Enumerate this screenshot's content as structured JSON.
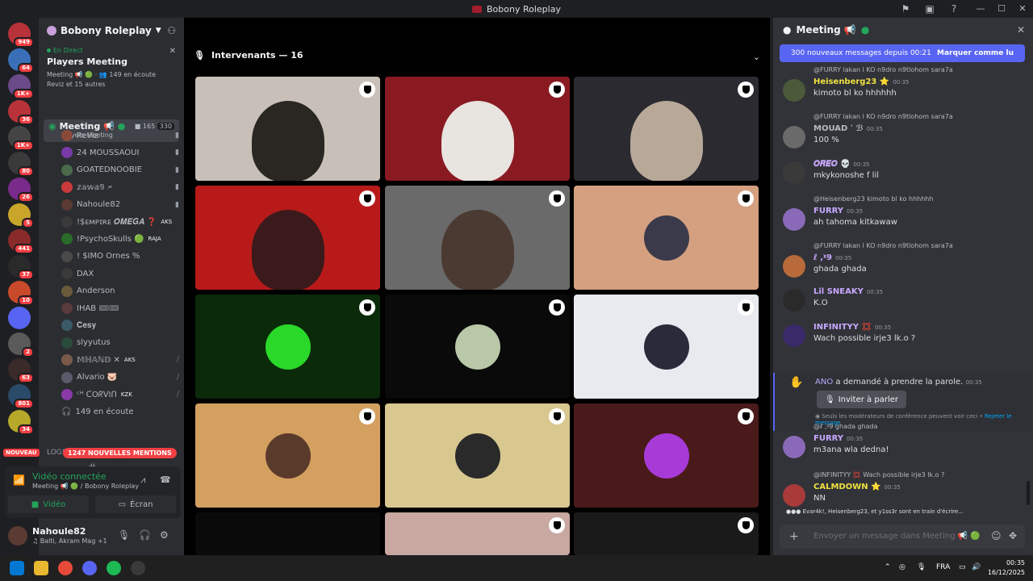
{
  "window": {
    "title": "Bobony Roleplay"
  },
  "guilds": [
    {
      "badge": "949",
      "color": "#b8323a"
    },
    {
      "badge": "64",
      "color": "#3a6fb8"
    },
    {
      "badge": "1K+",
      "color": "#6b4a8a"
    },
    {
      "badge": "36",
      "color": "#b8323a"
    },
    {
      "badge": "1K+",
      "color": "#444"
    },
    {
      "badge": "80",
      "color": "#3a3a3a"
    },
    {
      "badge": "26",
      "color": "#7a2a8a"
    },
    {
      "badge": "5",
      "color": "#c9a52a"
    },
    {
      "badge": "441",
      "color": "#8a2a2a"
    },
    {
      "badge": "37",
      "color": "#2a2a2a"
    },
    {
      "badge": "10",
      "color": "#c94a2a"
    },
    {
      "badge": "",
      "color": "#5865f2"
    },
    {
      "badge": "2",
      "color": "#5a5a5a"
    },
    {
      "badge": "63",
      "color": "#3a2a2a"
    },
    {
      "badge": "801",
      "color": "#2a4a6a"
    },
    {
      "badge": "34",
      "color": "#b8a82a"
    }
  ],
  "server": {
    "name": "Bobony Roleplay"
  },
  "live": {
    "tag": "En Direct",
    "title": "Players Meeting",
    "sub": "Meeting 📢 🟢 · 👥 149 en écoute",
    "sub2": "Reviz et 15 autres"
  },
  "voice_channel": {
    "name": "Meeting 📢",
    "sub": "Players Meeting",
    "count1": "165",
    "count2": "330"
  },
  "voice_users": [
    {
      "name": "Reviz",
      "color": "#8a4a3a",
      "right": "▮",
      "tag": ""
    },
    {
      "name": "24 MOUSSAOUI",
      "color": "#7a3aa8",
      "right": "▮",
      "tag": ""
    },
    {
      "name": "GOATEDNOOBIE",
      "color": "#4a6a4a",
      "right": "▮",
      "tag": ""
    },
    {
      "name": "𝕫𝕒𝕨𝕒𝟡 🗲",
      "color": "#c93a3a",
      "right": "▮",
      "tag": ""
    },
    {
      "name": "Nahoule82",
      "color": "#5a3a32",
      "right": "▮",
      "tag": ""
    },
    {
      "name": "!$ᴇᴍᴘɪʀᴇ 𝑶𝑴𝑬𝑮𝑨 ❓",
      "color": "#3a3a3a",
      "right": "",
      "tag": "AKS"
    },
    {
      "name": "!PsychoSkulls 🟢",
      "color": "#2a6a2a",
      "right": "",
      "tag": "RAJA"
    },
    {
      "name": "! $IMO Ornes %",
      "color": "#4a4a4a",
      "right": "",
      "tag": ""
    },
    {
      "name": "DAX",
      "color": "#3a3a3a",
      "right": "",
      "tag": ""
    },
    {
      "name": "Anderson",
      "color": "#6a5a3a",
      "right": "",
      "tag": ""
    },
    {
      "name": "IHAB 🎟🎟",
      "color": "#5a3a3a",
      "right": "",
      "tag": ""
    },
    {
      "name": "𝐂𝐞𝐬𝐲",
      "color": "#3a5a6a",
      "right": "",
      "tag": ""
    },
    {
      "name": "slyyutus",
      "color": "#2a4a3a",
      "right": "",
      "tag": ""
    },
    {
      "name": "𝕄ℍ𝔸ℕ𝔻 ✕",
      "color": "#7a5a4a",
      "right": "⧸",
      "tag": "AKS"
    },
    {
      "name": "Alvario 🐷",
      "color": "#5a5a6a",
      "right": "⧸",
      "tag": ""
    },
    {
      "name": "ᶜᴴ ᑕOᖇᐯIᑎ",
      "color": "#8a3aa8",
      "right": "⧸",
      "tag": "KZK"
    }
  ],
  "listening": "149 en écoute",
  "logs_label": "LOGS ⌄",
  "mentions": "1247 NOUVELLES MENTIONS",
  "nouveau": "NOUVEAU",
  "voice_panel": {
    "status": "Vidéo connectée",
    "sub": "Meeting 📢 🟢 / Bobony Roleplay",
    "video": "Vidéo",
    "screen": "Écran"
  },
  "user": {
    "name": "Nahoule82",
    "status": "♫ Balti, Akram Mag +1"
  },
  "stage": {
    "header": "Intervenants — 16"
  },
  "tiles": [
    {
      "bg": "#c8c0b8",
      "person": "#2a2622",
      "avatar": ""
    },
    {
      "bg": "#8a1a22",
      "person": "#e8e4e0",
      "avatar": ""
    },
    {
      "bg": "#2a2a30",
      "person": "#b8a898",
      "avatar": ""
    },
    {
      "bg": "#b81a1a",
      "person": "#3a1a1a",
      "avatar": ""
    },
    {
      "bg": "#6a6a6a",
      "person": "#4a3a32",
      "avatar": ""
    },
    {
      "bg": "#d4a080",
      "person": "",
      "avatar": "#3a3a4a"
    },
    {
      "bg": "#0a2a0a",
      "person": "",
      "avatar": "#2ad82a"
    },
    {
      "bg": "#0a0a0a",
      "person": "",
      "avatar": "#b8c8a8"
    },
    {
      "bg": "#e8eaf0",
      "person": "",
      "avatar": "#2a2a3a"
    },
    {
      "bg": "#d4a060",
      "person": "",
      "avatar": "#5a3a2a"
    },
    {
      "bg": "#d8c890",
      "person": "",
      "avatar": "#2a2a2a"
    },
    {
      "bg": "#4a1a1a",
      "person": "",
      "avatar": "#a83ad8"
    },
    {
      "bg": "#0a0a0a",
      "person": "",
      "avatar": ""
    },
    {
      "bg": "#c8a8a0",
      "person": "",
      "avatar": ""
    },
    {
      "bg": "#1a1a1a",
      "person": "",
      "avatar": ""
    }
  ],
  "chat": {
    "title": "Meeting 📢",
    "new_messages": "300 nouveaux messages depuis 00:21",
    "mark_read": "Marquer comme lu",
    "messages": [
      {
        "reply": "@FURRY lakan l KO n9dro n9tlohom sara7a",
        "author": "Heisenberg23 ⭐",
        "color": "#f0e040",
        "time": "00:35",
        "text": "kimoto bl ko hhhhhh",
        "av": "#4a5a3a"
      },
      {
        "reply": "@FURRY lakan l KO n9dro n9tlohom sara7a",
        "author": "MOUAD ˈ ℬ",
        "color": "#b5bac1",
        "time": "00:35",
        "text": "100 %",
        "av": "#6a6a6a"
      },
      {
        "reply": "",
        "author": "𝑶𝑹𝑬𝑶 💀",
        "color": "#c8a8ff",
        "time": "00:35",
        "text": "mkykonoshe f lil",
        "av": "#3a3a3a"
      },
      {
        "reply": "@Heisenberg23 kimoto bl ko hhhhhh",
        "author": "FURRY",
        "color": "#c8a8ff",
        "time": "00:35",
        "text": "ah tahoma kitkawaw",
        "av": "#8a6ab8"
      },
      {
        "reply": "@FURRY lakan l KO n9dro n9tlohom sara7a",
        "author": "ℓ ,ᵡ9",
        "color": "#c8a8ff",
        "time": "00:35",
        "text": "ghada ghada",
        "av": "#b86a3a"
      },
      {
        "reply": "",
        "author": "Lil SNEAKY",
        "color": "#c8a8ff",
        "time": "00:35",
        "text": "K.O",
        "av": "#2a2a2a"
      },
      {
        "reply": "",
        "author": "INFINITYY 💢",
        "color": "#c8a8ff",
        "time": "00:35",
        "text": "Wach possible irje3 lk.o ?",
        "av": "#3a2a6a"
      }
    ],
    "request": {
      "user": "ANO",
      "text": "a demandé à prendre la parole.",
      "time": "00:35",
      "invite": "Inviter à parler",
      "note": "Seuls les modérateurs de conférence peuvent voir ceci •",
      "reject": "Rejeter le message"
    },
    "messages2": [
      {
        "reply": "@ℓ ,ᵡ9 ghada ghada",
        "author": "FURRY",
        "color": "#c8a8ff",
        "time": "00:35",
        "text": "m3ana wla dedna!",
        "av": "#8a6ab8"
      },
      {
        "reply": "@INFINITYY 💢 Wach possible irje3 lk.o ?",
        "author": "CALMDOWN ⭐",
        "color": "#f0e040",
        "time": "00:35",
        "text": "NN",
        "av": "#a83a3a"
      }
    ],
    "typing": "Evar4k!, Heisenberg23, et y1ss3r sont en train d'écrire...",
    "input_placeholder": "Envoyer un message dans Meeting 📢 🟢"
  },
  "taskbar": {
    "lang": "FRA",
    "time": "00:35",
    "date": "16/12/2025"
  }
}
